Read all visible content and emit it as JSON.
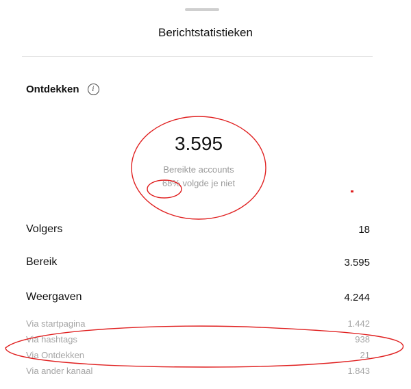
{
  "sheet": {
    "title": "Berichtstatistieken"
  },
  "discover": {
    "title": "Ontdekken",
    "reach_value": "3.595",
    "reach_label": "Bereikte accounts",
    "not_following": "68% volgde je niet"
  },
  "stats": [
    {
      "label": "Volgers",
      "value": "18"
    },
    {
      "label": "Bereik",
      "value": "3.595"
    },
    {
      "label": "Weergaven",
      "value": "4.244"
    }
  ],
  "substats": [
    {
      "label": "Via startpagina",
      "value": "1.442"
    },
    {
      "label": "Via hashtags",
      "value": "938"
    },
    {
      "label": "Via Ontdekken",
      "value": "21"
    },
    {
      "label": "Via ander kanaal",
      "value": "1.843"
    }
  ],
  "annotation_color": "#e02020"
}
